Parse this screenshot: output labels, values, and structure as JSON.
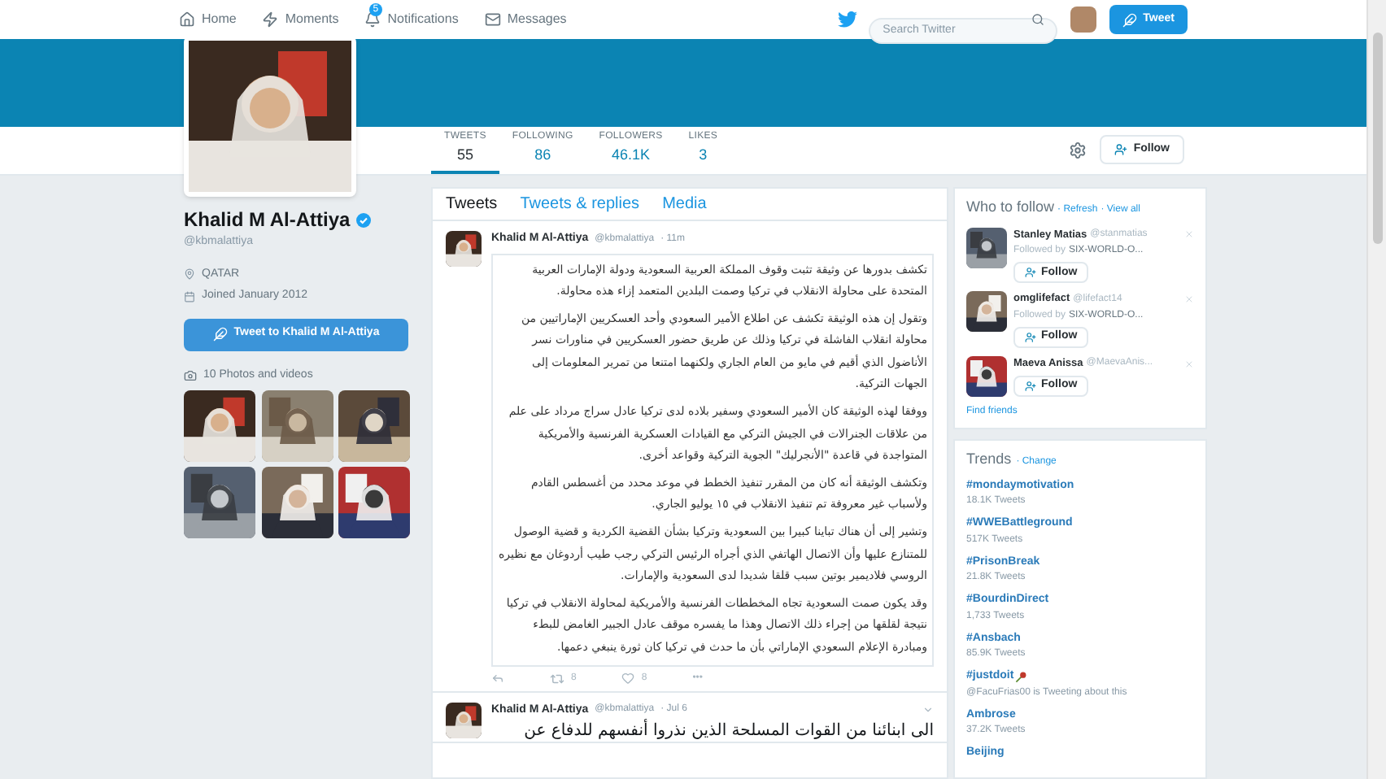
{
  "top_nav": {
    "items": [
      {
        "label": "Home",
        "kind": "home",
        "selected": false
      },
      {
        "label": "Moments",
        "kind": "moments",
        "selected": false
      },
      {
        "label": "Notifications",
        "kind": "notifications",
        "selected": false,
        "badge": "5"
      },
      {
        "label": "Messages",
        "kind": "messages",
        "selected": false
      }
    ],
    "search": {
      "placeholder": "Search Twitter"
    },
    "tweet_button": "Tweet"
  },
  "profile": {
    "name": "Khalid M Al-Attiya",
    "verified": true,
    "handle": "@kbmalattiya",
    "location": "QATAR",
    "joined": "Joined January 2012",
    "tweet_to_button": "Tweet to Khalid M Al-Attiya",
    "photos_label": "10 Photos and videos"
  },
  "stats": [
    {
      "label": "TWEETS",
      "value": "55",
      "selected": true
    },
    {
      "label": "FOLLOWING",
      "value": "86",
      "selected": false
    },
    {
      "label": "FOLLOWERS",
      "value": "46.1K",
      "selected": false
    },
    {
      "label": "LIKES",
      "value": "3",
      "selected": false
    }
  ],
  "follow_button": "Follow",
  "tabs": [
    {
      "label": "Tweets",
      "selected": true
    },
    {
      "label": "Tweets & replies",
      "selected": false
    },
    {
      "label": "Media",
      "selected": false
    }
  ],
  "tweets": [
    {
      "name": "Khalid M Al-Attiya",
      "handle": "@kbmalattiya",
      "time": "· 11m",
      "boxed": true,
      "paragraphs": [
        "تكشف بدورها عن وثيقة تثبت وقوف المملكة العربية السعودية ودولة الإمارات العربية المتحدة على محاولة الانقلاب في تركيا وصمت البلدين المتعمد إزاء هذه محاولة.",
        "وتقول إن هذه الوثيقة تكشف عن اطلاع الأمير السعودي وأحد العسكريين الإماراتيين من محاولة انقلاب الفاشلة في تركيا وذلك عن طريق حضور العسكريين في مناورات نسر الأناضول الذي أقيم في مايو من العام الجاري ولكنهما امتنعا من تمرير المعلومات إلى الجهات التركية.",
        "ووفقا لهذه الوثيقة كان الأمير السعودي وسفير بلاده لدى تركيا عادل سراج مرداد على علم من علاقات الجنرالات في الجيش التركي مع القيادات العسكرية الفرنسية والأمريكية المتواجدة في قاعدة \"الأنجرليك\" الجوية التركية وقواعد أخرى.",
        "وتكشف الوثيقة أنه كان من المقرر تنفيذ الخطط في موعد محدد من أغسطس القادم ولأسباب غير معروفة تم تنفيذ الانقلاب في ١٥ يوليو الجاري.",
        "وتشير إلى أن هناك تباينا كبيرا بين السعودية وتركيا بشأن القضية الكردية و قضية الوصول للمتنازع عليها وأن الاتصال الهاتفي الذي أجراه الرئيس التركي رجب طيب أردوغان مع نظيره الروسي فلاديمير بوتين سبب قلقا شديدا لدى السعودية والإمارات.",
        "وقد يكون صمت السعودية تجاه المخططات الفرنسية والأمريكية لمحاولة الانقلاب في تركيا نتيجة لقلقها من إجراء ذلك الاتصال وهذا ما يفسره موقف عادل الجبير الغامض للبطء ومبادرة الإعلام السعودي الإماراتي بأن ما حدث في تركيا كان ثورة ينبغي دعمها."
      ],
      "retweets": "8",
      "likes": "8",
      "more": "•••"
    },
    {
      "name": "Khalid M Al-Attiya",
      "handle": "@kbmalattiya",
      "time": "· Jul 6",
      "boxed": false,
      "paragraphs": [
        "الى ابنائنا من القوات المسلحة الذين نذروا أنفسهم للدفاع عن"
      ]
    }
  ],
  "who_to_follow": {
    "title": "Who to follow",
    "refresh": "· Refresh",
    "view_all": "· View all",
    "users": [
      {
        "name": "Stanley Matias",
        "handle": "@stanmatias",
        "followed_by": "Followed by",
        "followed_by_name": "SIX-WORLD-O...",
        "follow": "Follow"
      },
      {
        "name": "omglifefact",
        "handle": "@lifefact14",
        "followed_by": "Followed by",
        "followed_by_name": "SIX-WORLD-O...",
        "follow": "Follow"
      },
      {
        "name": "Maeva Anissa",
        "handle": "@MaevaAnis...",
        "follow": "Follow"
      }
    ],
    "find_friends": "Find friends"
  },
  "trends": {
    "title": "Trends",
    "change": "· Change",
    "items": [
      {
        "name": "#mondaymotivation",
        "meta": "18.1K Tweets"
      },
      {
        "name": "#WWEBattleground",
        "meta": "517K Tweets"
      },
      {
        "name": "#PrisonBreak",
        "meta": "21.8K Tweets"
      },
      {
        "name": "#BourdinDirect",
        "meta": "1,733 Tweets"
      },
      {
        "name": "#Ansbach",
        "meta": "85.9K Tweets"
      },
      {
        "name": "#justdoit",
        "meta": "@FacuFrias00 is Tweeting about this",
        "emoji": true
      },
      {
        "name": "Ambrose",
        "meta": "37.2K Tweets"
      },
      {
        "name": "Beijing"
      }
    ]
  }
}
